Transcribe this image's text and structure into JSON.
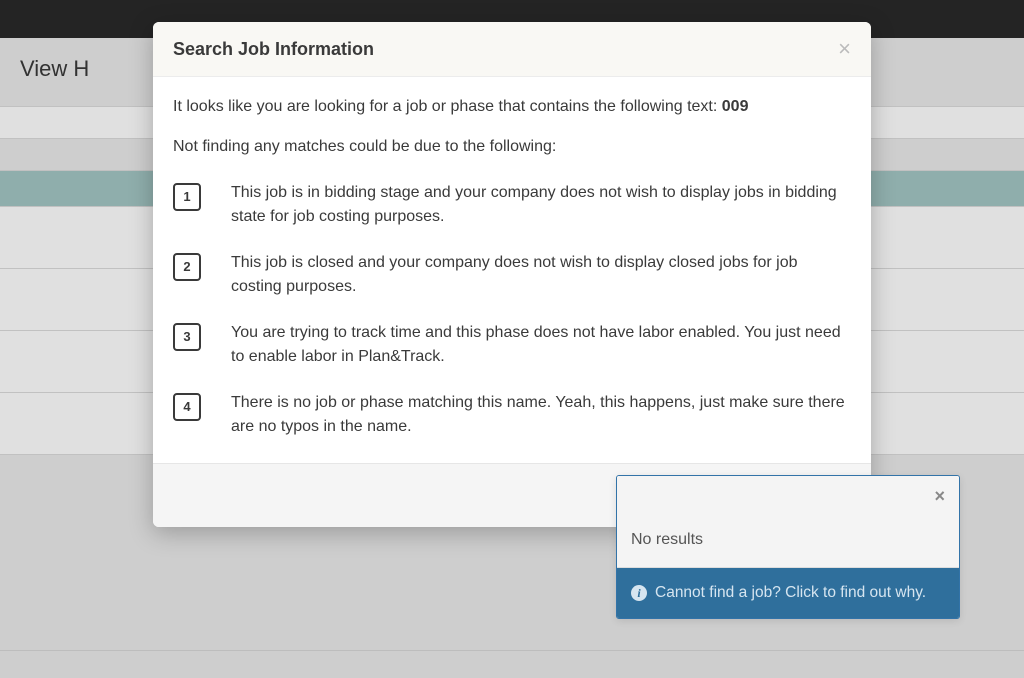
{
  "page": {
    "view_header": "View H"
  },
  "modal": {
    "title": "Search Job Information",
    "intro_prefix": "It looks like you are looking for a job or phase that contains the following text: ",
    "search_term": "009",
    "subintro": "Not finding any matches could be due to the following:",
    "reasons": [
      {
        "num": "1",
        "text": "This job is in bidding stage and your company does not wish to display jobs in bidding state for job costing purposes."
      },
      {
        "num": "2",
        "text": "This job is closed and your company does not wish to display closed jobs for job costing purposes."
      },
      {
        "num": "3",
        "text": "You are trying to track time and this phase does not have labor enabled. You just need to enable labor in Plan&Track."
      },
      {
        "num": "4",
        "text": "There is no job or phase matching this name. Yeah, this happens, just make sure there are no typos in the name."
      }
    ],
    "close_label": "Close"
  },
  "dropdown": {
    "no_results": "No results",
    "helper_text": "Cannot find a job? Click to find out why."
  }
}
